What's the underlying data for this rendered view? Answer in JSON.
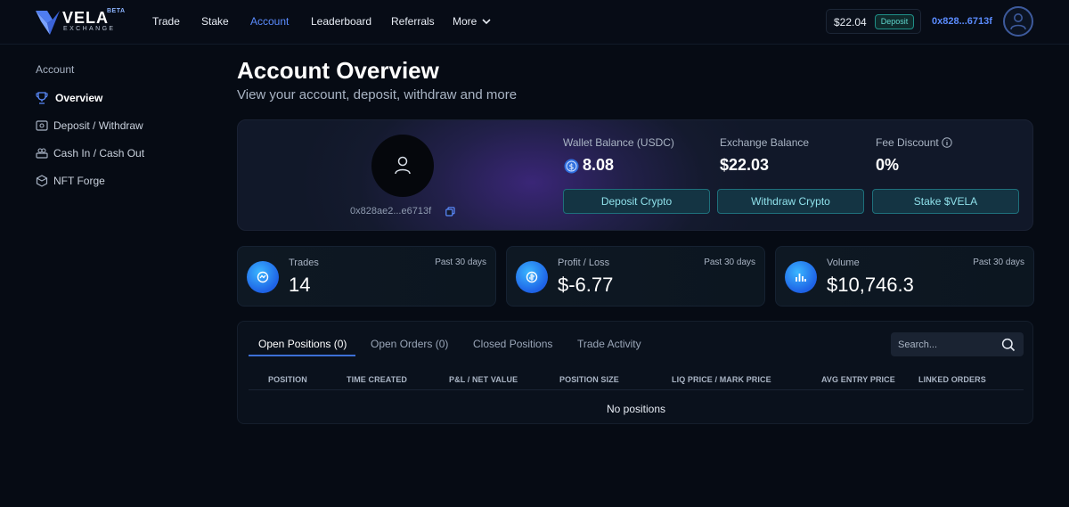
{
  "header": {
    "logo": {
      "word": "VELA",
      "sub": "EXCHANGE",
      "badge": "BETA"
    },
    "nav": [
      {
        "label": "Trade"
      },
      {
        "label": "Stake"
      },
      {
        "label": "Account"
      },
      {
        "label": "Leaderboard"
      },
      {
        "label": "Referrals"
      },
      {
        "label": "More"
      }
    ],
    "balance": "$22.04",
    "deposit_label": "Deposit",
    "wallet_address": "0x828...6713f"
  },
  "sidebar": {
    "title": "Account",
    "items": [
      {
        "label": "Overview",
        "icon": "trophy-icon"
      },
      {
        "label": "Deposit / Withdraw",
        "icon": "wallet-icon"
      },
      {
        "label": "Cash In / Cash Out",
        "icon": "cash-icon"
      },
      {
        "label": "NFT Forge",
        "icon": "hexagon-icon"
      }
    ]
  },
  "main": {
    "title": "Account Overview",
    "subtitle": "View your account, deposit, withdraw and more",
    "overview": {
      "address": "0x828ae2...e6713f",
      "wallet_balance_label": "Wallet Balance (USDC)",
      "wallet_balance": "8.08",
      "exchange_balance_label": "Exchange Balance",
      "exchange_balance": "$22.03",
      "fee_discount_label": "Fee Discount",
      "fee_discount": "0%",
      "buttons": {
        "deposit": "Deposit Crypto",
        "withdraw": "Withdraw Crypto",
        "stake": "Stake $VELA"
      }
    },
    "metrics": [
      {
        "label": "Trades",
        "period": "Past 30 days",
        "value": "14"
      },
      {
        "label": "Profit / Loss",
        "period": "Past 30 days",
        "value": "$-6.77"
      },
      {
        "label": "Volume",
        "period": "Past 30 days",
        "value": "$10,746.3"
      }
    ],
    "positions": {
      "tabs": [
        {
          "label": "Open Positions (0)"
        },
        {
          "label": "Open Orders (0)"
        },
        {
          "label": "Closed Positions"
        },
        {
          "label": "Trade Activity"
        }
      ],
      "search_placeholder": "Search...",
      "columns": [
        "POSITION",
        "TIME CREATED",
        "P&L / NET VALUE",
        "POSITION SIZE",
        "LIQ PRICE / MARK PRICE",
        "AVG ENTRY PRICE",
        "LINKED ORDERS"
      ],
      "empty_message": "No positions"
    }
  },
  "colors": {
    "accent": "#5b8cff",
    "teal": "#5fd6cc",
    "background": "#060b14"
  }
}
